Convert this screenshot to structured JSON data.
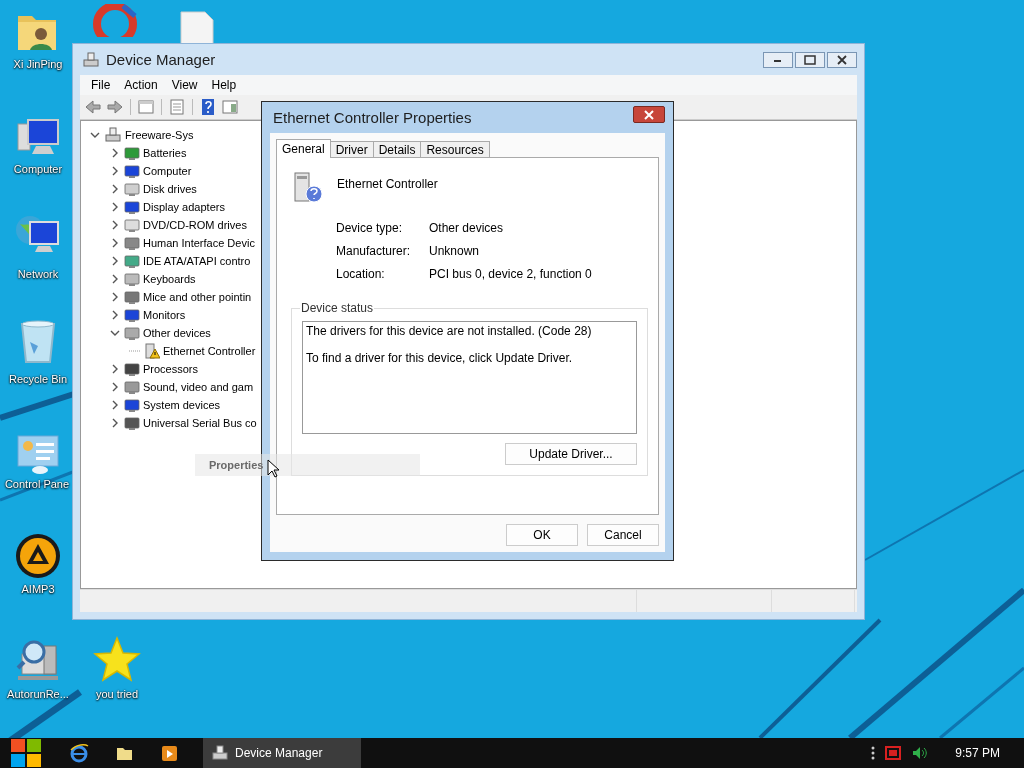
{
  "desktop_icons": [
    {
      "label": "Xi JinPing"
    },
    {
      "label": "Computer"
    },
    {
      "label": "Network"
    },
    {
      "label": "Recycle Bin"
    },
    {
      "label": "Control Pane"
    },
    {
      "label": "AIMP3"
    },
    {
      "label": "AutorunRe..."
    },
    {
      "label": "you tried"
    }
  ],
  "device_manager": {
    "title": "Device Manager",
    "menu": [
      "File",
      "Action",
      "View",
      "Help"
    ],
    "tree": {
      "label": "Freeware-Sys",
      "expanded": true,
      "children": [
        {
          "label": "Batteries",
          "expanded": false
        },
        {
          "label": "Computer",
          "expanded": false
        },
        {
          "label": "Disk drives",
          "expanded": false
        },
        {
          "label": "Display adapters",
          "expanded": false
        },
        {
          "label": "DVD/CD-ROM drives",
          "expanded": false
        },
        {
          "label": "Human Interface Devic",
          "expanded": false
        },
        {
          "label": "IDE ATA/ATAPI contro",
          "expanded": false
        },
        {
          "label": "Keyboards",
          "expanded": false
        },
        {
          "label": "Mice and other pointin",
          "expanded": false
        },
        {
          "label": "Monitors",
          "expanded": false
        },
        {
          "label": "Other devices",
          "expanded": true,
          "children": [
            {
              "label": "Ethernet Controller",
              "warning": true
            }
          ]
        },
        {
          "label": "Processors",
          "expanded": false
        },
        {
          "label": "Sound, video and gam",
          "expanded": false
        },
        {
          "label": "System devices",
          "expanded": false
        },
        {
          "label": "Universal Serial Bus co",
          "expanded": false
        }
      ]
    }
  },
  "context_menu": {
    "items": [
      "Properties"
    ]
  },
  "dialog": {
    "title": "Ethernet Controller Properties",
    "tabs": [
      {
        "label": "General",
        "selected": true
      },
      {
        "label": "Driver",
        "selected": false
      },
      {
        "label": "Details",
        "selected": false
      },
      {
        "label": "Resources",
        "selected": false
      }
    ],
    "device_name": "Ethernet Controller",
    "properties": [
      {
        "label": "Device type:",
        "value": "Other devices"
      },
      {
        "label": "Manufacturer:",
        "value": "Unknown"
      },
      {
        "label": "Location:",
        "value": "PCI bus 0, device 2, function 0"
      }
    ],
    "status_group": "Device status",
    "status_text": [
      "The drivers for this device are not installed. (Code 28)",
      "To find a driver for this device, click Update Driver."
    ],
    "update_button": "Update Driver...",
    "buttons": [
      "OK",
      "Cancel"
    ]
  },
  "taskbar": {
    "task": "Device Manager",
    "time": "9:57 PM"
  }
}
